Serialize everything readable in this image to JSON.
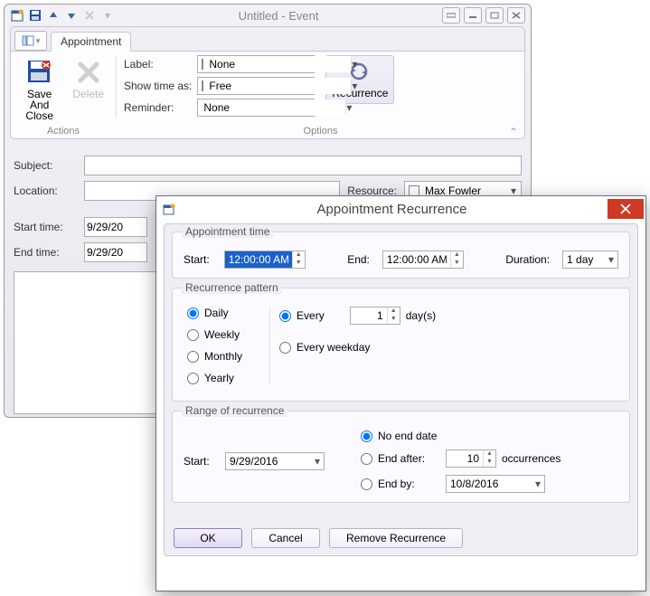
{
  "window": {
    "title": "Untitled - Event"
  },
  "ribbon": {
    "tab": "Appointment",
    "actions_label": "Actions",
    "options_label": "Options",
    "save_close": "Save And\nClose",
    "delete": "Delete",
    "label_lbl": "Label:",
    "label_val": "None",
    "show_as_lbl": "Show time as:",
    "show_as_val": "Free",
    "reminder_lbl": "Reminder:",
    "reminder_val": "None",
    "recurrence": "Recurrence"
  },
  "form": {
    "subject_lbl": "Subject:",
    "subject_val": "",
    "location_lbl": "Location:",
    "location_val": "",
    "resource_lbl": "Resource:",
    "resource_val": "Max Fowler",
    "start_lbl": "Start time:",
    "start_val": "9/29/20",
    "end_lbl": "End time:",
    "end_val": "9/29/20"
  },
  "modal": {
    "title": "Appointment Recurrence",
    "appt_time": {
      "legend": "Appointment time",
      "start_lbl": "Start:",
      "start_val": "12:00:00 AM",
      "end_lbl": "End:",
      "end_val": "12:00:00 AM",
      "duration_lbl": "Duration:",
      "duration_val": "1 day"
    },
    "pattern": {
      "legend": "Recurrence pattern",
      "daily": "Daily",
      "weekly": "Weekly",
      "monthly": "Monthly",
      "yearly": "Yearly",
      "every_lbl": "Every",
      "every_val": "1",
      "every_unit": "day(s)",
      "every_weekday": "Every weekday"
    },
    "range": {
      "legend": "Range of recurrence",
      "start_lbl": "Start:",
      "start_val": "9/29/2016",
      "no_end": "No end date",
      "end_after": "End after:",
      "end_after_val": "10",
      "occurrences": "occurrences",
      "end_by": "End by:",
      "end_by_val": "10/8/2016"
    },
    "buttons": {
      "ok": "OK",
      "cancel": "Cancel",
      "remove": "Remove Recurrence"
    }
  }
}
